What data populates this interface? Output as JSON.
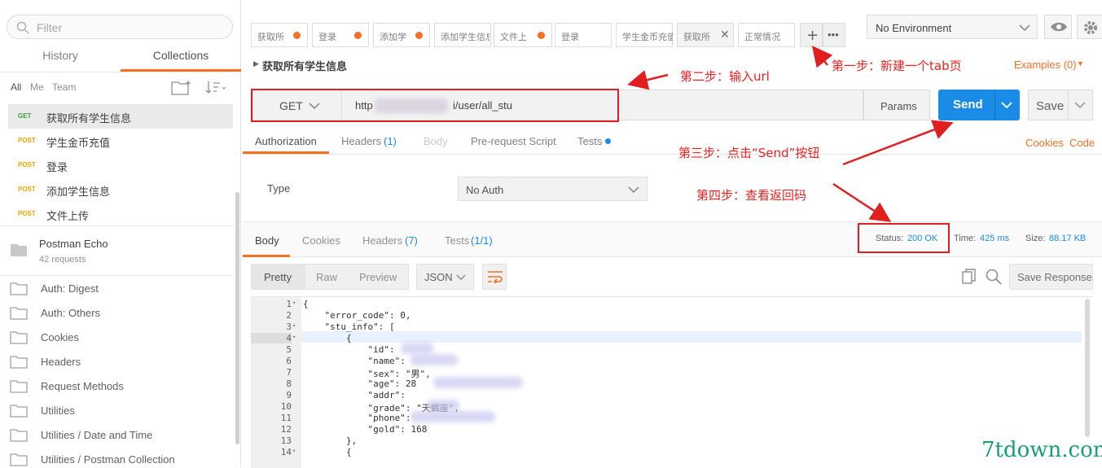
{
  "sidebar": {
    "filter_placeholder": "Filter",
    "tabs": [
      "History",
      "Collections"
    ],
    "sort_labels": [
      "All",
      "Me",
      "Team"
    ],
    "requests": [
      {
        "method": "GET",
        "name": "获取所有学生信息"
      },
      {
        "method": "POST",
        "name": "学生金币充值"
      },
      {
        "method": "POST",
        "name": "登录"
      },
      {
        "method": "POST",
        "name": "添加学生信息"
      },
      {
        "method": "POST",
        "name": "文件上传"
      }
    ],
    "collection": {
      "name": "Postman Echo",
      "count": "42 requests"
    },
    "folders": [
      "Auth: Digest",
      "Auth: Others",
      "Cookies",
      "Headers",
      "Request Methods",
      "Utilities",
      "Utilities / Date and Time",
      "Utilities / Postman Collection"
    ]
  },
  "tabs": [
    {
      "label": "获取所",
      "dot": true
    },
    {
      "label": "登录",
      "dot": true
    },
    {
      "label": "添加学",
      "dot": true
    },
    {
      "label": "添加学生信息",
      "dot": false
    },
    {
      "label": "文件上",
      "dot": true
    },
    {
      "label": "登录",
      "dot": false
    },
    {
      "label": "学生金币充值",
      "dot": false
    },
    {
      "label": "获取所",
      "dot": false
    },
    {
      "label": "正常情况",
      "dot": false
    }
  ],
  "environment": "No Environment",
  "request": {
    "title": "获取所有学生信息",
    "examples": "Examples (0)",
    "method": "GET",
    "url": "http://               /api/user/all_stu",
    "url_prefix": "http",
    "url_suffix": "i/user/all_stu",
    "params": "Params",
    "send": "Send",
    "save": "Save",
    "subtabs": [
      "Authorization",
      "Headers",
      "Body",
      "Pre-request Script",
      "Tests"
    ],
    "headers_count": "(1)",
    "cookies": "Cookies",
    "code": "Code",
    "type_label": "Type",
    "auth_value": "No Auth"
  },
  "response": {
    "tabs": [
      "Body",
      "Cookies",
      "Headers",
      "Tests"
    ],
    "headers_count": "(7)",
    "tests_count": "(1/1)",
    "status_label": "Status:",
    "status": "200 OK",
    "time_label": "Time:",
    "time": "425 ms",
    "size_label": "Size:",
    "size": "88.17 KB",
    "view_buttons": [
      "Pretty",
      "Raw",
      "Preview"
    ],
    "format": "JSON",
    "save_response": "Save Response",
    "line_numbers": [
      "1",
      "2",
      "3",
      "4",
      "5",
      "6",
      "7",
      "8",
      "9",
      "10",
      "11",
      "12",
      "13",
      "14"
    ],
    "code_lines": [
      "{",
      "    \"error_code\": 0,",
      "    \"stu_info\": [",
      "        {",
      "            \"id\":",
      "            \"name\":",
      "            \"sex\": \"男\",",
      "            \"age\": 28",
      "            \"addr\":",
      "            \"grade\": \"天蝎座\",",
      "            \"phone\":",
      "            \"gold\": 168",
      "        },",
      "        {"
    ]
  },
  "annotations": {
    "step1": "第一步：新建一个tab页",
    "step2": "第二步：输入url",
    "step3": "第三步：点击“Send”按钮",
    "step4": "第四步：查看返回码"
  },
  "watermark": "7tdown.com"
}
